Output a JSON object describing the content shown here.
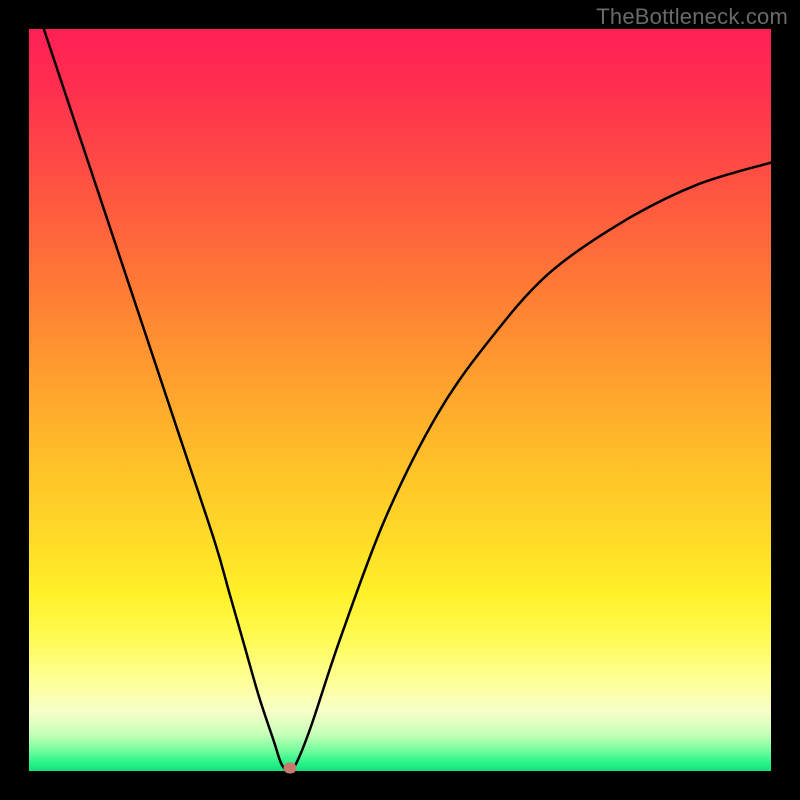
{
  "watermark": "TheBottleneck.com",
  "chart_data": {
    "type": "line",
    "title": "",
    "xlabel": "",
    "ylabel": "",
    "xlim": [
      0,
      100
    ],
    "ylim": [
      0,
      100
    ],
    "grid": false,
    "legend": false,
    "series": [
      {
        "name": "bottleneck-curve",
        "x": [
          2,
          5,
          10,
          15,
          20,
          25,
          27,
          29,
          31,
          33,
          34,
          35,
          36,
          38,
          42,
          48,
          55,
          62,
          70,
          80,
          90,
          100
        ],
        "y": [
          100,
          91,
          76,
          61,
          46,
          31,
          24,
          17,
          10,
          4,
          1,
          0,
          1,
          6,
          18,
          34,
          48,
          58,
          67,
          74,
          79,
          82
        ]
      }
    ],
    "marker": {
      "x": 35.2,
      "y": 0.4,
      "color": "#c97a6e"
    },
    "background_gradient": {
      "orientation": "vertical",
      "stops": [
        {
          "pos": 0.0,
          "color": "#ff1f55"
        },
        {
          "pos": 0.5,
          "color": "#ffbf29"
        },
        {
          "pos": 0.85,
          "color": "#feff99"
        },
        {
          "pos": 1.0,
          "color": "#17e07e"
        }
      ]
    }
  }
}
